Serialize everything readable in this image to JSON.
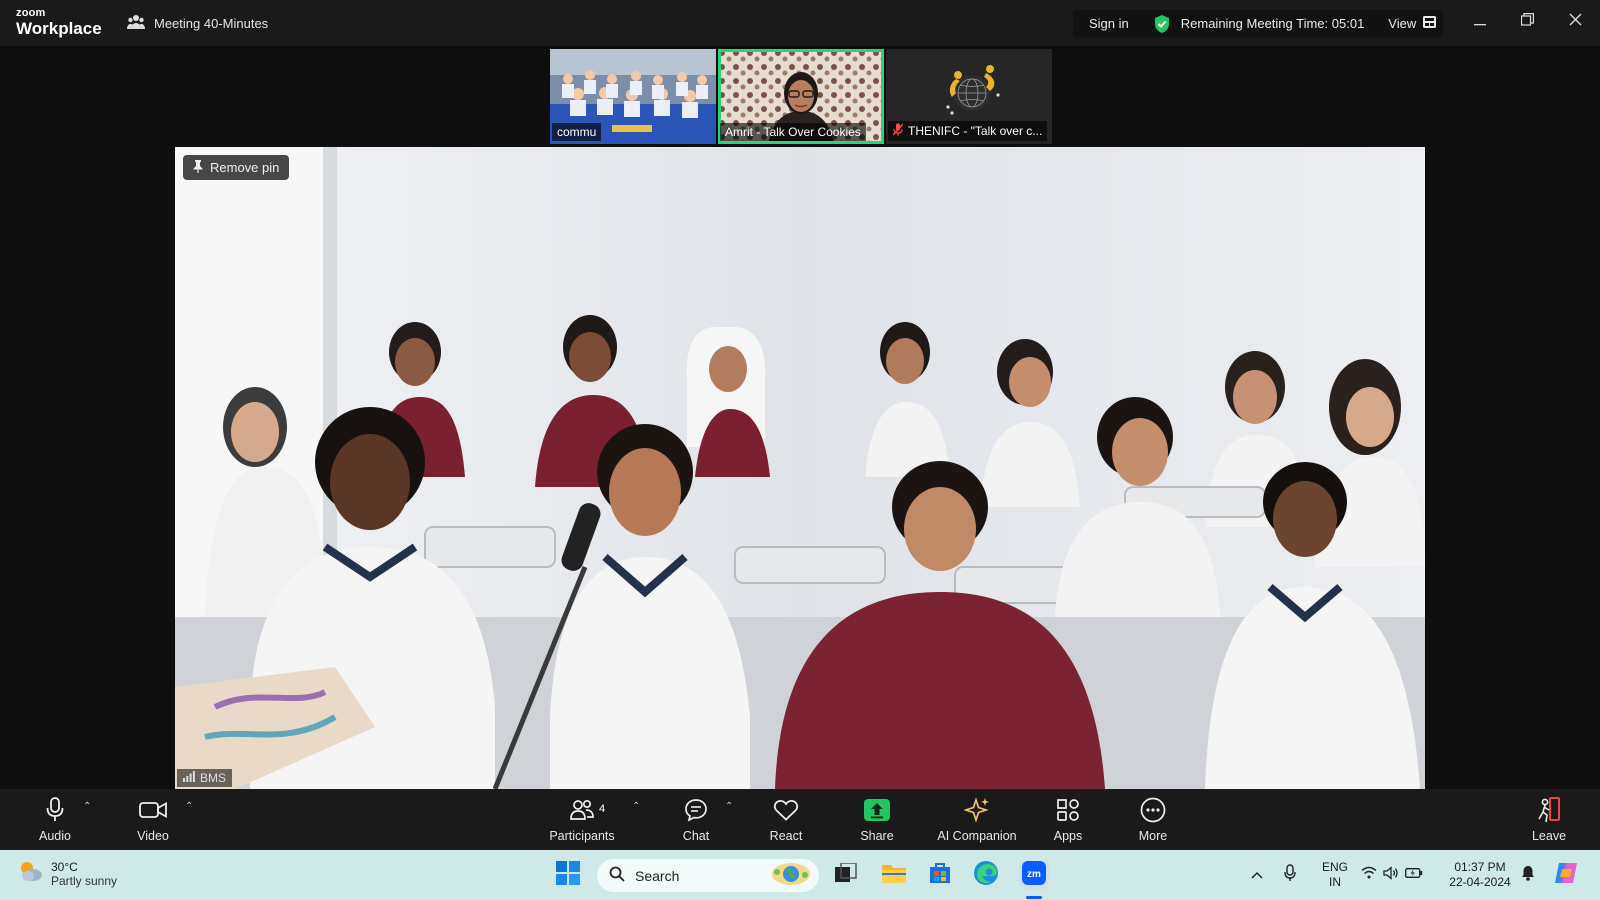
{
  "window": {
    "brand_top": "zoom",
    "brand_bottom": "Workplace",
    "meeting_label": "Meeting 40-Minutes",
    "sign_in": "Sign in",
    "remaining_time": "Remaining Meeting Time: 05:01",
    "view_label": "View",
    "accent_green": "#2ad47a"
  },
  "thumbnails": [
    {
      "name": "commu",
      "muted": false,
      "active": false
    },
    {
      "name": "Amrit - Talk Over Cookies",
      "muted": false,
      "active": true
    },
    {
      "name": "THENIFC - \"Talk over c...",
      "muted": true,
      "active": false
    }
  ],
  "main_video": {
    "remove_pin": "Remove pin",
    "participant_name": "BMS"
  },
  "toolbar": {
    "audio": "Audio",
    "video": "Video",
    "participants": "Participants",
    "participants_count": "4",
    "chat": "Chat",
    "react": "React",
    "share": "Share",
    "ai_companion": "AI Companion",
    "apps": "Apps",
    "more": "More",
    "leave": "Leave"
  },
  "taskbar": {
    "temperature": "30°C",
    "weather": "Partly sunny",
    "search_placeholder": "Search",
    "lang_top": "ENG",
    "lang_bottom": "IN",
    "time": "01:37 PM",
    "date": "22-04-2024"
  }
}
